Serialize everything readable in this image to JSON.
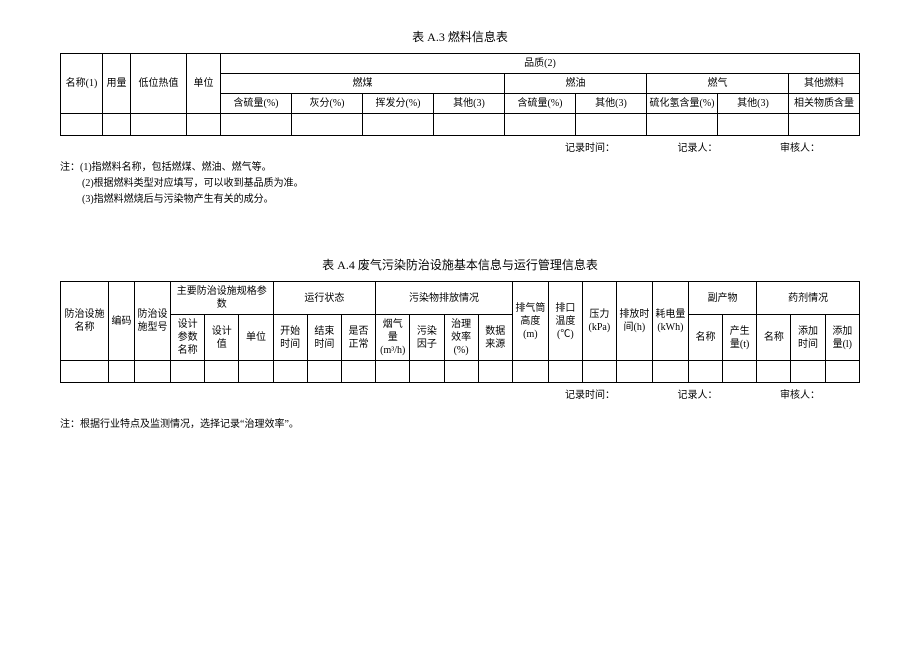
{
  "tableA3": {
    "caption": "表 A.3 燃料信息表",
    "headers": {
      "name": "名称(1)",
      "usage": "用量",
      "lowcal": "低位热值",
      "unit": "单位",
      "quality": "品质(2)",
      "coal": "燃煤",
      "oil": "燃油",
      "gas": "燃气",
      "other_fuel": "其他燃料",
      "sulfur_pct": "含硫量(%)",
      "ash_pct": "灰分(%)",
      "volatile_pct": "挥发分(%)",
      "other3": "其他(3)",
      "h2s_content": "硫化氢含量(%)",
      "related_content": "相关物质含量"
    },
    "footer": {
      "record_time": "记录时间：",
      "recorder": "记录人：",
      "reviewer": "审核人："
    },
    "notes": {
      "prefix": "注：",
      "n1": "(1)指燃料名称，包括燃煤、燃油、燃气等。",
      "n2": "(2)根据燃料类型对应填写，可以收到基品质为准。",
      "n3": "(3)指燃料燃烧后与污染物产生有关的成分。"
    }
  },
  "tableA4": {
    "caption": "表 A.4 废气污染防治设施基本信息与运行管理信息表",
    "headers": {
      "facility_name": "防治设施名称",
      "code": "编码",
      "facility_model": "防治设施型号",
      "main_spec": "主要防治设施规格参数",
      "run_state": "运行状态",
      "emission": "污染物排放情况",
      "stack_height": "排气筒高度(m)",
      "outlet_temp": "排口温度(℃)",
      "pressure": "压力(kPa)",
      "emit_time": "排放时间(h)",
      "power": "耗电量(kWh)",
      "byproduct": "副产物",
      "chemical": "药剂情况",
      "design_param_name": "设计参数名称",
      "design_value": "设计值",
      "unit": "单位",
      "start_time": "开始时间",
      "end_time": "结束时间",
      "is_normal": "是否正常",
      "flue_gas": "烟气量(m³/h)",
      "pollution_factor": "污染因子",
      "treat_eff": "治理效率(%)",
      "data_source": "数据来源",
      "name": "名称",
      "produce_qty": "产生量(t)",
      "add_time": "添加时间",
      "add_qty": "添加量(l)"
    },
    "footer": {
      "record_time": "记录时间：",
      "recorder": "记录人：",
      "reviewer": "审核人："
    },
    "notes": {
      "prefix": "注：",
      "n1": "根据行业特点及监测情况，选择记录“治理效率”。"
    }
  }
}
